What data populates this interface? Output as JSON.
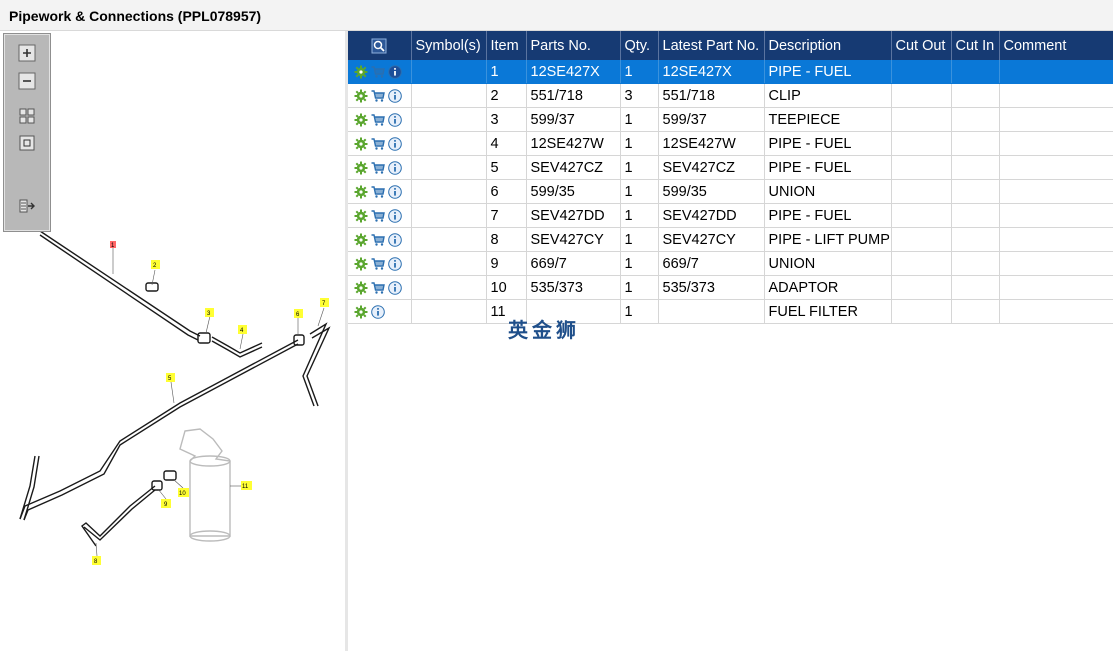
{
  "window": {
    "title": "Pipework & Connections (PPL078957)"
  },
  "toolbox": {
    "tools": [
      {
        "name": "zoom-in-icon"
      },
      {
        "name": "zoom-out-icon"
      },
      {
        "name": "fit-grid-icon"
      },
      {
        "name": "actual-size-icon"
      },
      {
        "name": "export-icon"
      }
    ]
  },
  "diagram": {
    "callouts": [
      "1",
      "2",
      "3",
      "4",
      "5",
      "6",
      "7",
      "8",
      "9",
      "10",
      "11"
    ]
  },
  "table": {
    "columns": [
      "Symbol(s)",
      "Item",
      "Parts No.",
      "Qty.",
      "Latest Part No.",
      "Description",
      "Cut Out",
      "Cut In",
      "Comment"
    ],
    "rows": [
      {
        "item": "1",
        "parts_no": "12SE427X",
        "qty": "1",
        "latest": "12SE427X",
        "desc": "PIPE - FUEL",
        "cart": true,
        "selected": true
      },
      {
        "item": "2",
        "parts_no": "551/718",
        "qty": "3",
        "latest": "551/718",
        "desc": "CLIP",
        "cart": true
      },
      {
        "item": "3",
        "parts_no": "599/37",
        "qty": "1",
        "latest": "599/37",
        "desc": "TEEPIECE",
        "cart": true
      },
      {
        "item": "4",
        "parts_no": "12SE427W",
        "qty": "1",
        "latest": "12SE427W",
        "desc": "PIPE - FUEL",
        "cart": true
      },
      {
        "item": "5",
        "parts_no": "SEV427CZ",
        "qty": "1",
        "latest": "SEV427CZ",
        "desc": "PIPE - FUEL",
        "cart": true
      },
      {
        "item": "6",
        "parts_no": "599/35",
        "qty": "1",
        "latest": "599/35",
        "desc": "UNION",
        "cart": true
      },
      {
        "item": "7",
        "parts_no": "SEV427DD",
        "qty": "1",
        "latest": "SEV427DD",
        "desc": "PIPE - FUEL",
        "cart": true
      },
      {
        "item": "8",
        "parts_no": "SEV427CY",
        "qty": "1",
        "latest": "SEV427CY",
        "desc": "PIPE - LIFT PUMP T",
        "cart": true
      },
      {
        "item": "9",
        "parts_no": "669/7",
        "qty": "1",
        "latest": "669/7",
        "desc": "UNION",
        "cart": true
      },
      {
        "item": "10",
        "parts_no": "535/373",
        "qty": "1",
        "latest": "535/373",
        "desc": "ADAPTOR",
        "cart": true
      },
      {
        "item": "11",
        "parts_no": "",
        "qty": "1",
        "latest": "",
        "desc": "FUEL FILTER",
        "cart": false
      }
    ]
  },
  "watermark": {
    "text": "英金狮"
  },
  "colors": {
    "header_bg": "#163a73",
    "selected_row": "#0a78d7",
    "gear_green": "#5aa62e",
    "cart_blue": "#2b6fb0"
  }
}
